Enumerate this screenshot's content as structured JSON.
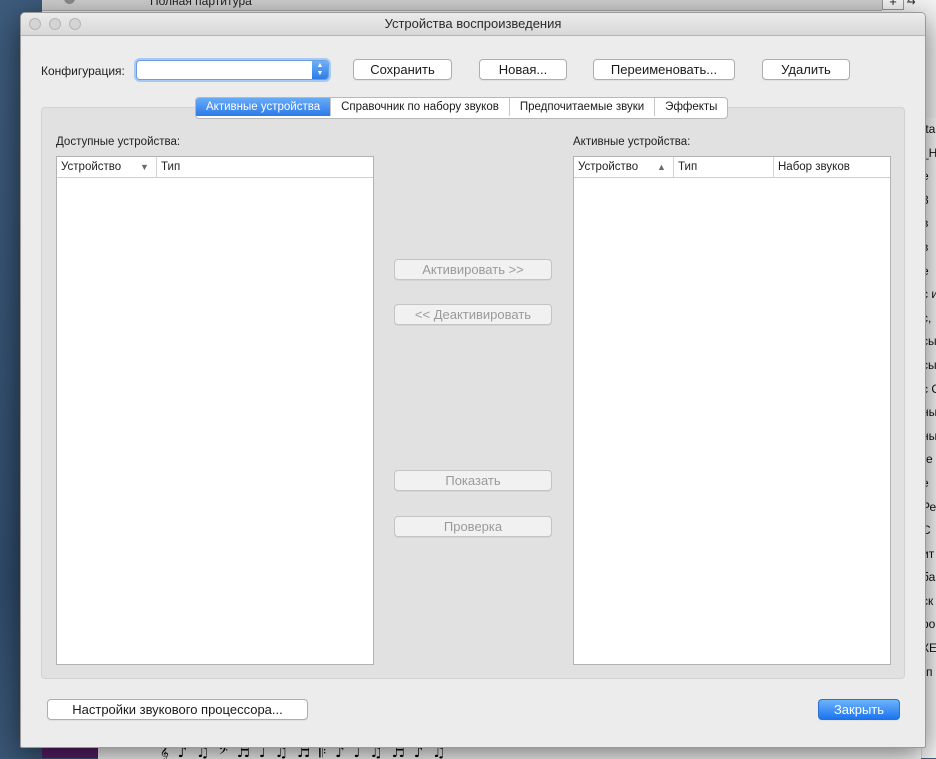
{
  "background_app": {
    "tab_title": "Полная партитура",
    "plus_label": "+",
    "corner_label": "⇆",
    "right_column_fragments": [
      "tta",
      "_H",
      "e",
      "3",
      "в",
      "в",
      "е",
      "с и",
      "с,",
      "сы",
      "сы",
      "с С",
      "ны",
      "ны",
      "(е",
      "е",
      "Ре",
      "С",
      "ит",
      "ба",
      "ск",
      "ро",
      "КЕ",
      "(п"
    ],
    "score_glyphs": "𝄞 ♪ ♫ 𝄢 ♬ ♩ ♫ ♬ 𝄆 ♪ ♩ ♫ ♬ ♪ ♫"
  },
  "dialog": {
    "title": "Устройства воспроизведения",
    "config": {
      "label": "Конфигурация:",
      "value": ""
    },
    "toolbar": {
      "save": "Сохранить",
      "new": "Новая...",
      "rename": "Переименовать...",
      "delete": "Удалить"
    },
    "tabs": [
      {
        "label": "Активные устройства",
        "active": true
      },
      {
        "label": "Справочник по набору звуков",
        "active": false
      },
      {
        "label": "Предпочитаемые звуки",
        "active": false
      },
      {
        "label": "Эффекты",
        "active": false
      }
    ],
    "available": {
      "label": "Доступные устройства:",
      "columns": [
        "Устройство",
        "Тип"
      ],
      "sort_indicator": "▼",
      "rows": []
    },
    "active": {
      "label": "Активные устройства:",
      "columns": [
        "Устройство",
        "Тип",
        "Набор звуков"
      ],
      "sort_indicator": "▲",
      "rows": []
    },
    "middle_buttons": {
      "activate": "Активировать >>",
      "deactivate": "<< Деактивировать",
      "show": "Показать",
      "test": "Проверка"
    },
    "footer": {
      "processor_settings": "Настройки звукового процессора...",
      "close": "Закрыть"
    }
  }
}
